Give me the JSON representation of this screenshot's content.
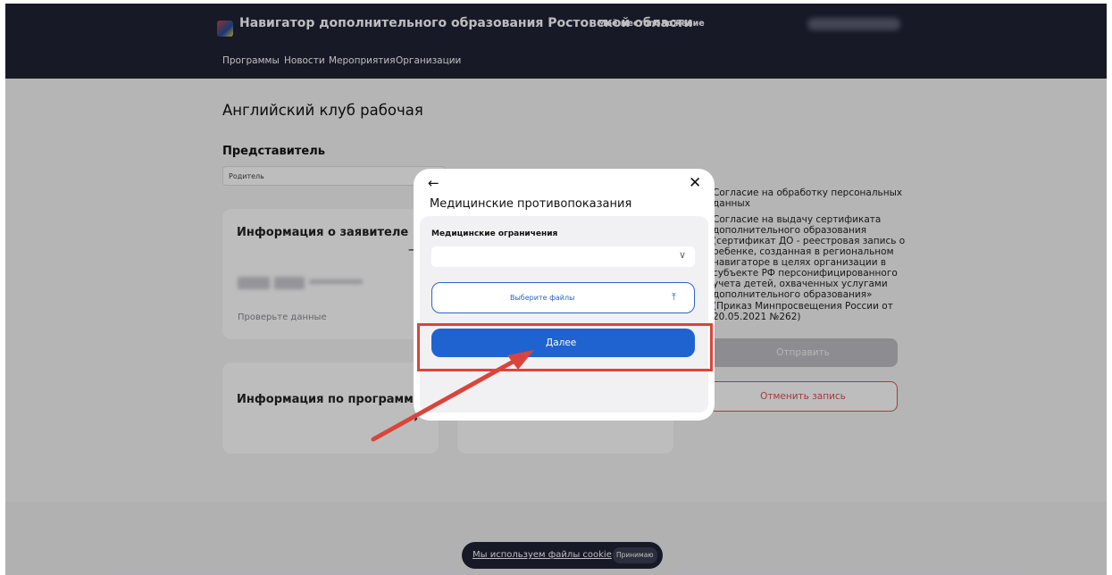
{
  "header": {
    "title": "Навигатор дополнительного образования Ростовской области",
    "location_link": "Моё местоположение",
    "logo_icon": "region-emblem-icon"
  },
  "nav": {
    "items": [
      "Программы",
      "Новости",
      "Мероприятия",
      "Организации"
    ]
  },
  "page": {
    "title": "Английский клуб рабочая",
    "representative_label": "Представитель",
    "representative_value": "Родитель"
  },
  "cards": {
    "applicant_title": "Информация о заявителе",
    "applicant_hint": "Проверьте данные",
    "program_title": "Информация по программе"
  },
  "consents": {
    "personal_data": "Согласие на обработку персональных данных",
    "certificate": "Согласие на выдачу сертификата дополнительного образования (сертификат ДО - реестровая запись о ребенке, созданная в региональном навигаторе в целях организации в субъекте РФ персонифицированного учета детей, охваченных услугами дополнительного образования» (Приказ Минпросвещения России от 20.05.2021 №262)",
    "certificate_lines": [
      "Согласие на выдачу сертификата",
      "дополнительного образования",
      "(сертификат ДО - реестровая запись о",
      "ребенке, созданная в региональном",
      "навигаторе в целях организации в",
      "субъекте РФ персонифицированного",
      "учета детей, охваченных услугами",
      "дополнительного образования»",
      "(Приказ Минпросвещения России от",
      "20.05.2021 №262)"
    ],
    "personal_lines": [
      "Согласие на обработку персональных",
      "данных"
    ],
    "submit_label": "Отправить",
    "cancel_label": "Отменить запись"
  },
  "modal": {
    "title": "Медицинские противопоказания",
    "back_icon": "arrow-left-icon",
    "close_icon": "close-icon",
    "field_label": "Медицинские ограничения",
    "field_value": "",
    "file_button_label": "Выберите файлы",
    "next_label": "Далее"
  },
  "cookie": {
    "text": "Мы используем файлы cookie",
    "accept_label": "Принимаю"
  },
  "colors": {
    "header_bg": "#1f2235",
    "primary": "#1e63d0",
    "danger": "#e05050",
    "annotation": "#d9453c"
  }
}
